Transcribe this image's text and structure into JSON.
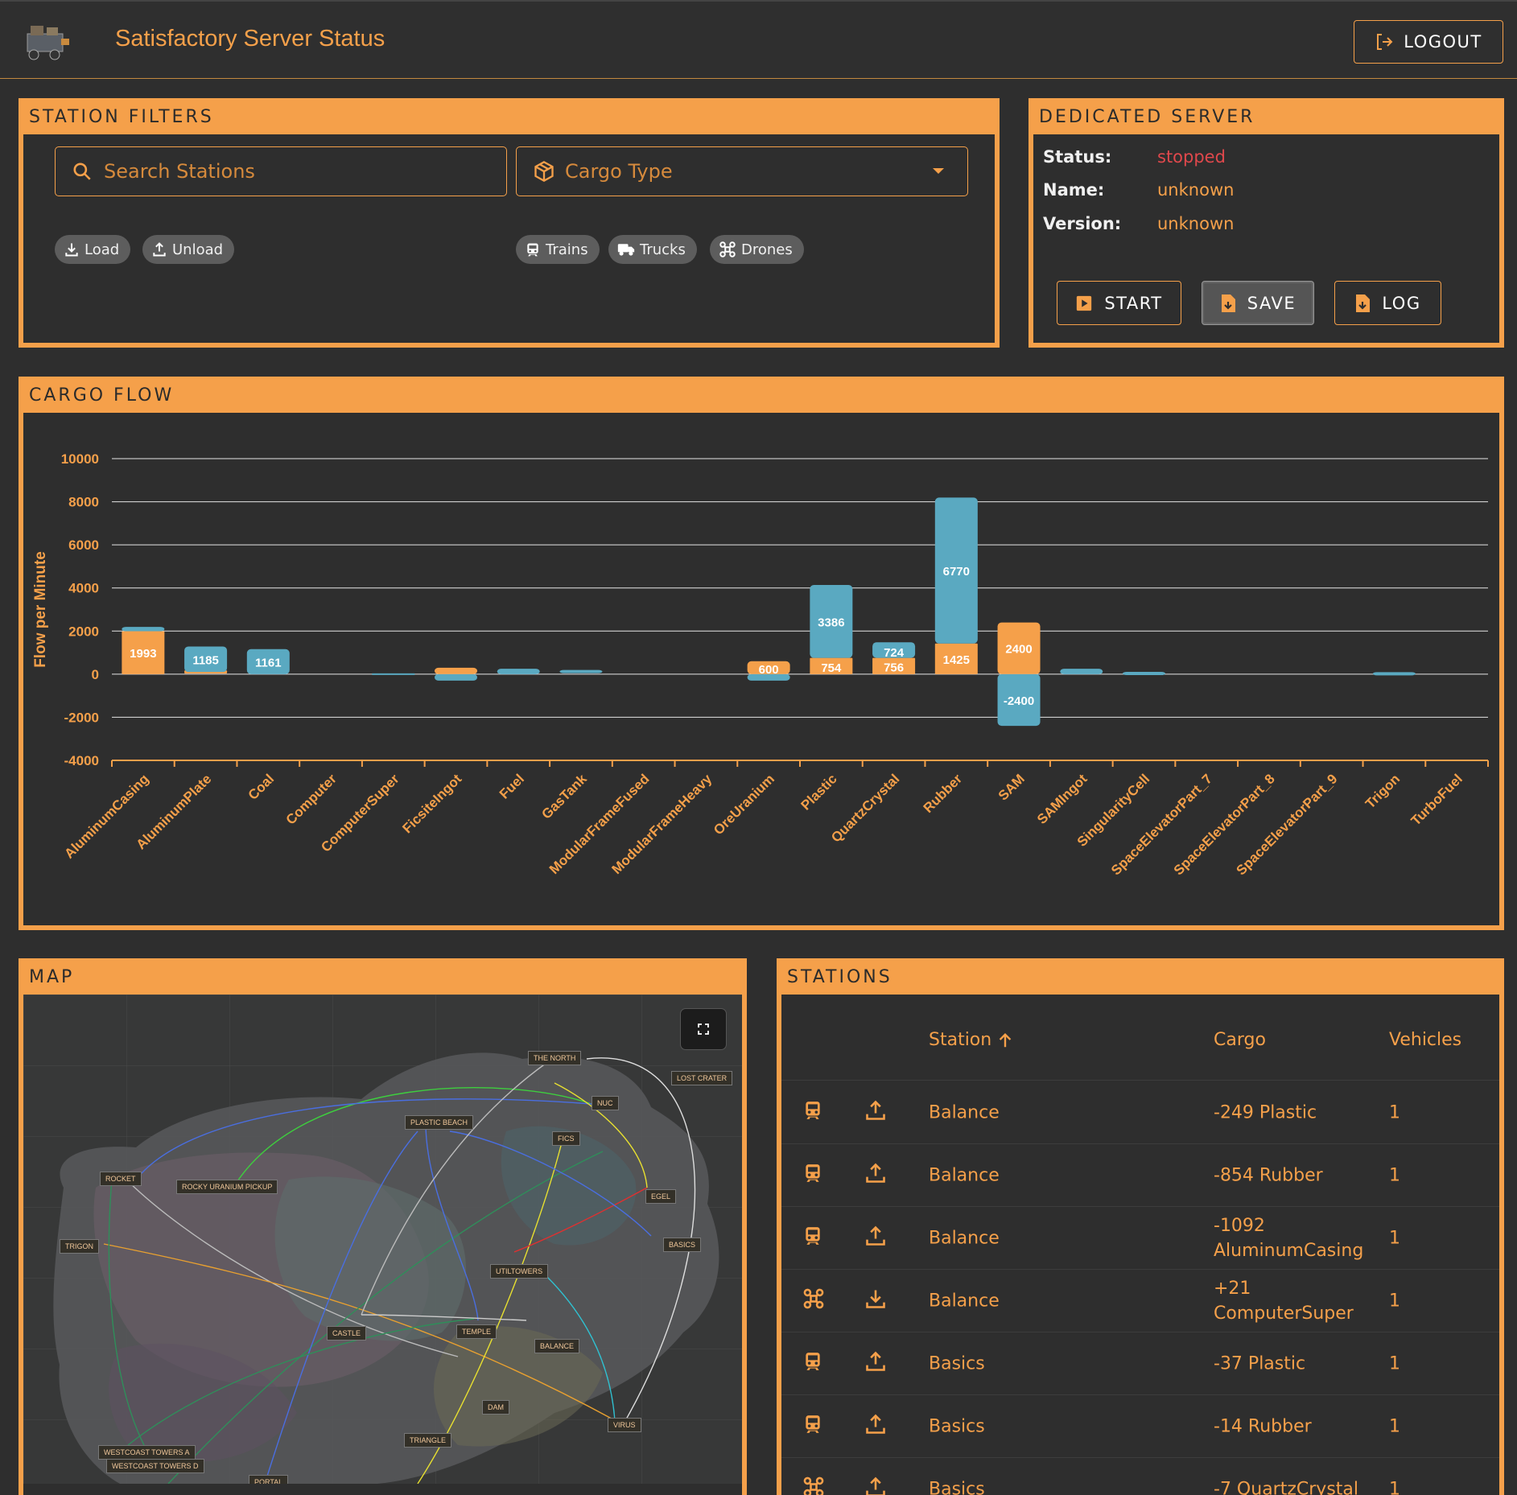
{
  "app": {
    "title": "Satisfactory Server Status",
    "logout_label": "LOGOUT"
  },
  "filters": {
    "title": "STATION FILTERS",
    "search_placeholder": "Search Stations",
    "cargo_placeholder": "Cargo Type",
    "chips": {
      "load": "Load",
      "unload": "Unload",
      "trains": "Trains",
      "trucks": "Trucks",
      "drones": "Drones"
    }
  },
  "server": {
    "title": "DEDICATED SERVER",
    "status_label": "Status:",
    "status_value": "stopped",
    "name_label": "Name:",
    "name_value": "unknown",
    "version_label": "Version:",
    "version_value": "unknown",
    "start_label": "START",
    "save_label": "SAVE",
    "log_label": "LOG",
    "status_color": "#e0484c"
  },
  "cargo_flow": {
    "title": "CARGO FLOW"
  },
  "chart_data": {
    "type": "bar",
    "stacked": true,
    "ylabel": "Flow per Minute",
    "xlabel": "",
    "ylim": [
      -4000,
      10000
    ],
    "yticks": [
      10000,
      8000,
      6000,
      4000,
      2000,
      0,
      -2000,
      -4000
    ],
    "grid": true,
    "categories": [
      "AluminumCasing",
      "AluminumPlate",
      "Coal",
      "Computer",
      "ComputerSuper",
      "FicsiteIngot",
      "Fuel",
      "GasTank",
      "ModularFrameFused",
      "ModularFrameHeavy",
      "OreUranium",
      "Plastic",
      "QuartzCrystal",
      "Rubber",
      "SAM",
      "SAMIngot",
      "SingularityCell",
      "SpaceElevatorPart_7",
      "SpaceElevatorPart_8",
      "SpaceElevatorPart_9",
      "Trigon",
      "TurboFuel"
    ],
    "series": [
      {
        "color": "#f5a04a",
        "values": [
          1993,
          100,
          0,
          0,
          0,
          300,
          0,
          0,
          0,
          0,
          600,
          754,
          756,
          1425,
          2400,
          0,
          0,
          0,
          0,
          0,
          0,
          0
        ],
        "labels": [
          "1993",
          "",
          "",
          "",
          "",
          "",
          "",
          "",
          "",
          "",
          "600",
          "754",
          "756",
          "1425",
          "2400",
          "",
          "",
          "",
          "",
          "",
          "",
          ""
        ]
      },
      {
        "color": "#5aa9c1",
        "values": [
          200,
          1185,
          1161,
          0,
          0,
          -300,
          250,
          120,
          0,
          0,
          -300,
          3386,
          724,
          6770,
          -2400,
          250,
          30,
          0,
          0,
          0,
          20,
          0
        ],
        "labels": [
          "",
          "1185",
          "1161",
          "",
          "",
          "",
          "",
          "",
          "",
          "",
          "",
          "3386",
          "724",
          "6770",
          "-2400",
          "",
          "",
          "",
          "",
          "",
          "",
          ""
        ]
      }
    ]
  },
  "map": {
    "title": "MAP",
    "locations": [
      "THE NORTH",
      "LOST CRATER",
      "NUC",
      "PLASTIC BEACH",
      "FICS",
      "ROCKET",
      "ROCKY URANIUM PICKUP",
      "EGEL",
      "TRIGON",
      "BASICS",
      "UTILTOWERS",
      "CASTLE",
      "TEMPLE",
      "BALANCE",
      "DAM",
      "VIRUS",
      "TRIANGLE",
      "WESTCOAST TOWERS A",
      "WESTCOAST TOWERS D",
      "PORTAL"
    ]
  },
  "stations": {
    "title": "STATIONS",
    "headers": {
      "station": "Station",
      "cargo": "Cargo",
      "vehicles": "Vehicles"
    },
    "rows": [
      {
        "vehicle": "train-icon",
        "direction": "unload-icon",
        "name": "Balance",
        "cargo": "-249 Plastic",
        "vehicles": "1"
      },
      {
        "vehicle": "train-icon",
        "direction": "unload-icon",
        "name": "Balance",
        "cargo": "-854 Rubber",
        "vehicles": "1"
      },
      {
        "vehicle": "train-icon",
        "direction": "unload-icon",
        "name": "Balance",
        "cargo": "-1092 AluminumCasing",
        "vehicles": "1"
      },
      {
        "vehicle": "drone-icon",
        "direction": "load-icon",
        "name": "Balance",
        "cargo": "+21 ComputerSuper",
        "vehicles": "1"
      },
      {
        "vehicle": "train-icon",
        "direction": "unload-icon",
        "name": "Basics",
        "cargo": "-37 Plastic",
        "vehicles": "1"
      },
      {
        "vehicle": "train-icon",
        "direction": "unload-icon",
        "name": "Basics",
        "cargo": "-14 Rubber",
        "vehicles": "1"
      },
      {
        "vehicle": "drone-icon",
        "direction": "unload-icon",
        "name": "Basics",
        "cargo": "-7 QuartzCrystal",
        "vehicles": "1"
      }
    ]
  },
  "colors": {
    "accent": "#f5a04a",
    "secondary": "#5aa9c1",
    "background": "#2e2e2e",
    "error": "#e0484c"
  }
}
